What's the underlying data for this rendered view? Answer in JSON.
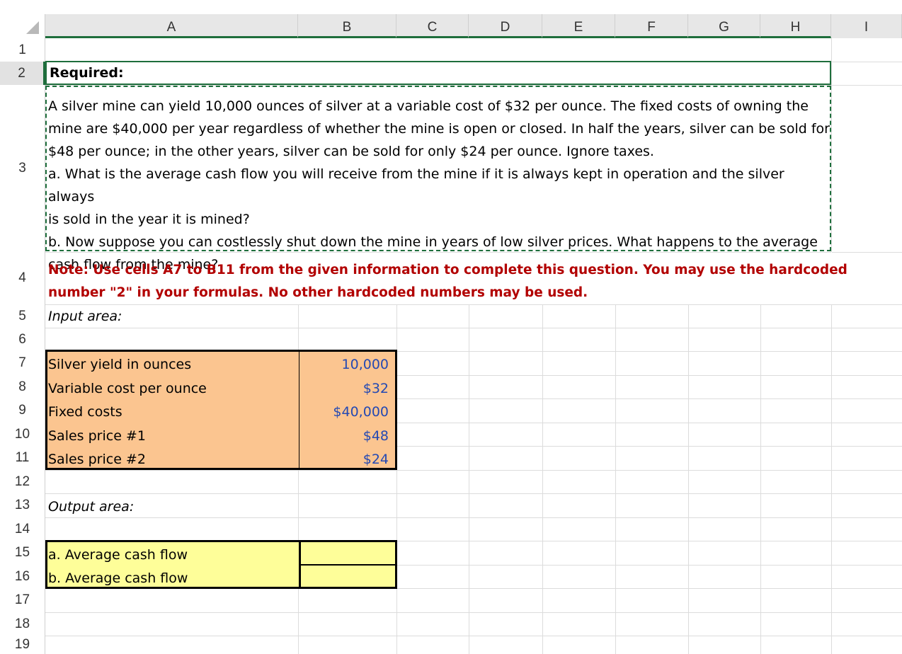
{
  "columns": [
    "A",
    "B",
    "C",
    "D",
    "E",
    "F",
    "G",
    "H",
    "I"
  ],
  "rows": [
    "1",
    "2",
    "3",
    "4",
    "5",
    "6",
    "7",
    "8",
    "9",
    "10",
    "11",
    "12",
    "13",
    "14",
    "15",
    "16",
    "17",
    "18",
    "19"
  ],
  "required_label": "Required:",
  "problem_lines": [
    "A silver mine can yield 10,000 ounces of silver at a variable cost of $32 per ounce. The fixed costs of owning the",
    "mine are $40,000 per year regardless of whether the mine is open or closed. In half the years, silver can be sold for",
    "$48 per ounce; in the other years, silver can be sold for only $24 per ounce. Ignore taxes.",
    "a. What is the average cash flow you will receive from the mine if it is always kept in operation and the silver always",
    "is sold in the year it is mined?",
    "b. Now suppose you can costlessly shut down the mine in years of low silver prices. What happens to the average",
    "cash flow from the mine?"
  ],
  "note_lines": [
    "Note: Use cells A7 to B11 from the given information to complete this question. You may use the hardcoded",
    "number \"2\" in your formulas. No other hardcoded numbers may be used."
  ],
  "input_area_label": "Input area:",
  "inputs": [
    {
      "label": "Silver yield in ounces",
      "value": "10,000"
    },
    {
      "label": "Variable cost per ounce",
      "value": "$32"
    },
    {
      "label": "Fixed costs",
      "value": "$40,000"
    },
    {
      "label": "Sales price #1",
      "value": "$48"
    },
    {
      "label": "Sales price #2",
      "value": "$24"
    }
  ],
  "output_area_label": "Output area:",
  "outputs": [
    {
      "label": "a. Average cash flow",
      "value": ""
    },
    {
      "label": "b. Average cash flow",
      "value": ""
    }
  ],
  "colors": {
    "input_fill": "#fbc590",
    "output_fill": "#fefe99",
    "note_text": "#b20000",
    "number_text": "#2449b3",
    "selection": "#1e6e3c"
  }
}
